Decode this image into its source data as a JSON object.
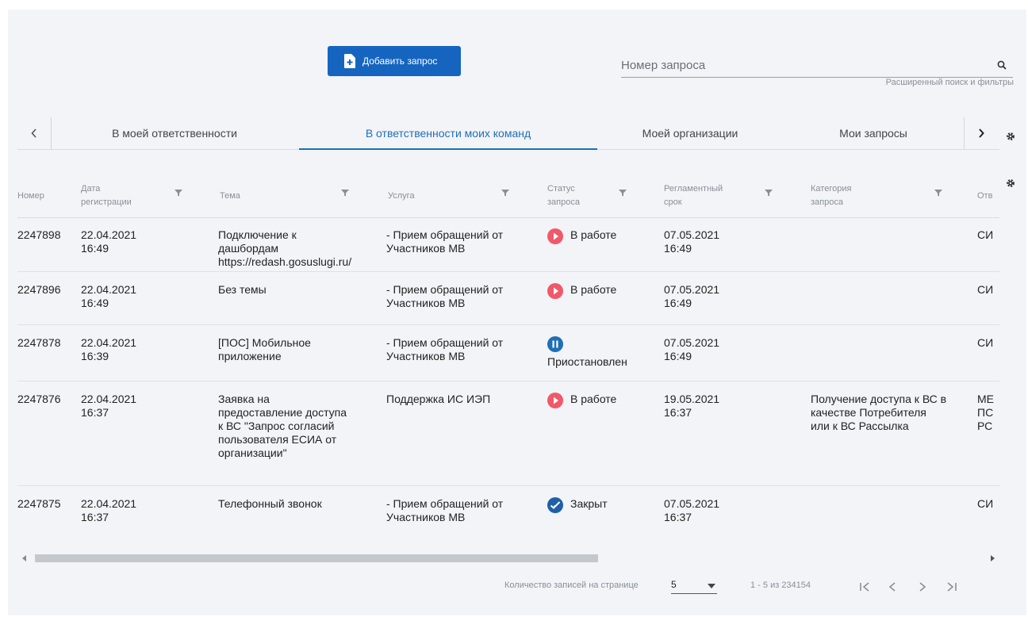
{
  "toolbar": {
    "add_label": "Добавить запрос",
    "search_placeholder": "Номер запроса",
    "advanced_search": "Расширенный поиск и фильтры"
  },
  "tabs": [
    {
      "label": "В моей ответственности",
      "active": false
    },
    {
      "label": "В ответственности моих команд",
      "active": true
    },
    {
      "label": "Моей организации",
      "active": false
    },
    {
      "label": "Мои запросы",
      "active": false
    }
  ],
  "table": {
    "columns": [
      "Номер",
      "Дата\nрегистрации",
      "Тема",
      "Услуга",
      "Статус\nзапроса",
      "Регламентный\nсрок",
      "Категория\nзапроса",
      "Отв"
    ],
    "rows": [
      {
        "num": "2247898",
        "date": "22.04.2021\n16:49",
        "topic": "Подключение к\nдашбордам\nhttps://redash.gosuslugi.ru/",
        "service": "- Прием обращений от\nУчастников МВ",
        "status": "В работе",
        "status_type": "work",
        "due": "07.05.2021\n16:49",
        "category": "",
        "resp": "СИ"
      },
      {
        "num": "2247896",
        "date": "22.04.2021\n16:49",
        "topic": "Без темы",
        "service": "- Прием обращений от\nУчастников МВ",
        "status": "В работе",
        "status_type": "work",
        "due": "07.05.2021\n16:49",
        "category": "",
        "resp": "СИ"
      },
      {
        "num": "2247878",
        "date": "22.04.2021\n16:39",
        "topic": "[ПОС] Мобильное\nприложение",
        "service": "- Прием обращений от\nУчастников МВ",
        "status": "Приостановлен",
        "status_type": "paused",
        "due": "07.05.2021\n16:49",
        "category": "",
        "resp": "СИ"
      },
      {
        "num": "2247876",
        "date": "22.04.2021\n16:37",
        "topic": "Заявка на\nпредоставление доступа\nк ВС \"Запрос согласий\nпользователя ЕСИА от\nорганизации\"",
        "service": "Поддержка ИС ИЭП",
        "status": "В работе",
        "status_type": "work",
        "due": "19.05.2021\n16:37",
        "category": "Получение доступа к ВС в\nкачестве Потребителя\nили к ВС Рассылка",
        "resp": "МЕ\nПС\nРС"
      },
      {
        "num": "2247875",
        "date": "22.04.2021\n16:37",
        "topic": "Телефонный звонок",
        "service": "- Прием обращений от\nУчастников МВ",
        "status": "Закрыт",
        "status_type": "closed",
        "due": "07.05.2021\n16:37",
        "category": "",
        "resp": "СИ"
      }
    ]
  },
  "pager": {
    "per_page_label": "Количество записей на странице",
    "per_page_value": "5",
    "range": "1 - 5 из 234154"
  },
  "colors": {
    "primary": "#1565c0",
    "status_work": "#f0596a",
    "status_paused": "#1f6fb6",
    "status_closed": "#1f5fa8"
  }
}
